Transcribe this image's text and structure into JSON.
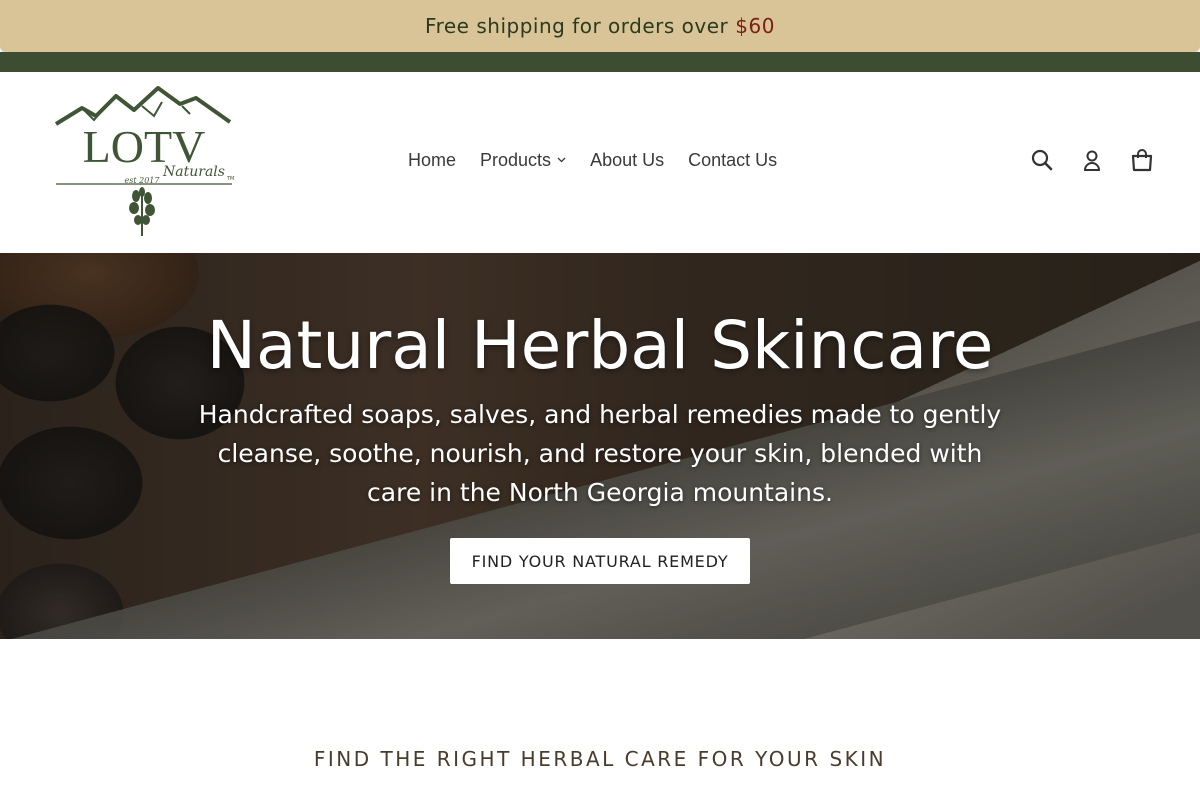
{
  "promo": {
    "text": "Free shipping for orders over",
    "price": "$60"
  },
  "logo": {
    "main": "LOTV",
    "script": "Naturals",
    "tm": "TM",
    "est": "est 2017"
  },
  "nav": {
    "home": "Home",
    "products": "Products",
    "about": "About Us",
    "contact": "Contact Us"
  },
  "icons": [
    "search-icon",
    "account-icon",
    "cart-icon"
  ],
  "hero": {
    "title": "Natural Herbal Skincare",
    "subtitle": "Handcrafted soaps, salves, and herbal remedies made to gently cleanse, soothe, nourish, and restore your skin, blended with care in the North Georgia mountains.",
    "button": "FIND YOUR NATURAL REMEDY"
  },
  "section": {
    "title": "FIND THE RIGHT HERBAL CARE FOR YOUR SKIN"
  },
  "colors": {
    "promo_bg": "#d9c497",
    "accent_green": "#3c4d31",
    "price_red": "#7a1f12"
  }
}
